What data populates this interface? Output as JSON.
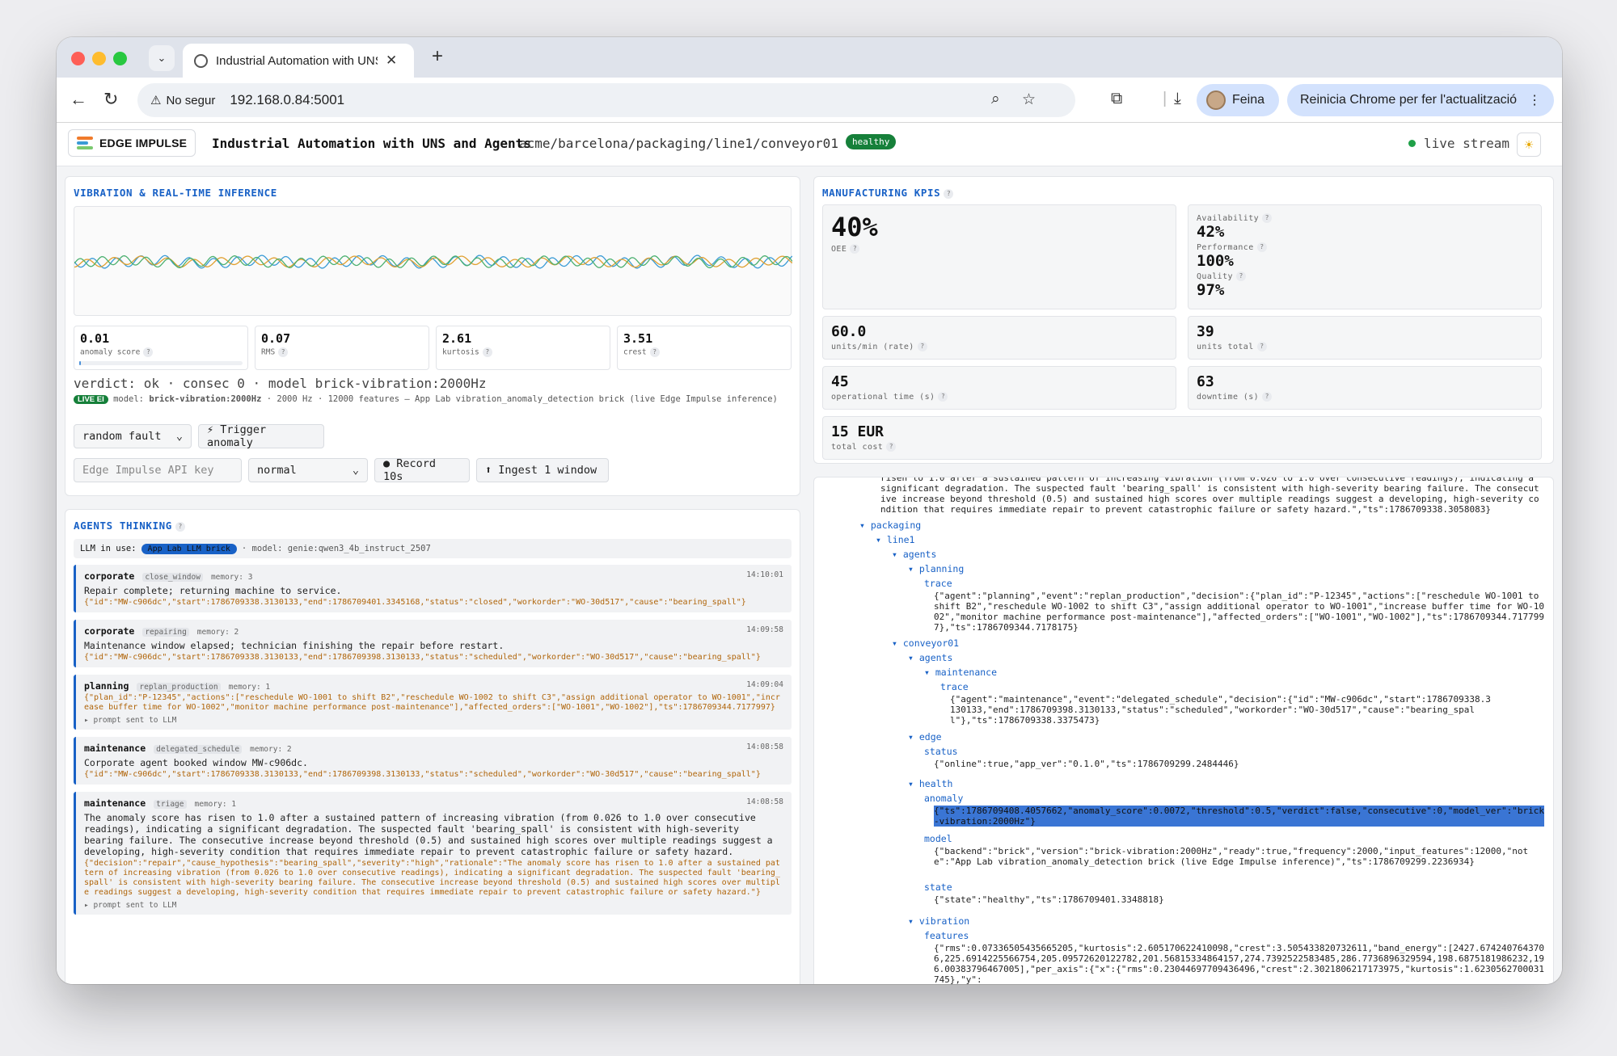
{
  "browser": {
    "tab_title": "Industrial Automation with UNS",
    "security_label": "No segur",
    "url": "192.168.0.84:5001",
    "profile_name": "Feina",
    "update_label": "Reinicia Chrome per fer l'actualització"
  },
  "header": {
    "logo_text": "EDGE IMPULSE",
    "title": "Industrial Automation with UNS and Agents",
    "topic_path": "acme/barcelona/packaging/line1/conveyor01",
    "health_badge": "healthy",
    "live_label": "live stream"
  },
  "vibration": {
    "title": "VIBRATION & REAL-TIME INFERENCE",
    "metrics": [
      {
        "value": "0.01",
        "label": "anomaly score",
        "fill": 0.01
      },
      {
        "value": "0.07",
        "label": "RMS"
      },
      {
        "value": "2.61",
        "label": "kurtosis"
      },
      {
        "value": "3.51",
        "label": "crest"
      }
    ],
    "verdict": "verdict: ok · consec 0 · model brick-vibration:2000Hz",
    "live_badge": "LIVE EI",
    "model_prefix": "model:",
    "model_name": "brick-vibration:2000Hz",
    "model_desc": " · 2000 Hz · 12000 features — App Lab vibration_anomaly_detection brick (live Edge Impulse inference)",
    "fault_select": "random fault",
    "trigger_button": "⚡ Trigger anomaly",
    "api_key_placeholder": "Edge Impulse API key",
    "mode_select": "normal",
    "record_button": "● Record 10s",
    "ingest_button": "⬆ Ingest 1 window"
  },
  "agents": {
    "title": "AGENTS THINKING",
    "llm_label": "LLM in use:",
    "llm_badge": "App Lab LLM brick",
    "llm_model": "· model: genie:qwen3_4b_instruct_2507",
    "cards": [
      {
        "agent": "corporate",
        "event": "close_window",
        "memory": "memory: 3",
        "time": "14:10:01",
        "message": "Repair complete; returning machine to service.",
        "json": "{\"id\":\"MW-c906dc\",\"start\":1786709338.3130133,\"end\":1786709401.3345168,\"status\":\"closed\",\"workorder\":\"WO-30d517\",\"cause\":\"bearing_spall\"}",
        "prompt": ""
      },
      {
        "agent": "corporate",
        "event": "repairing",
        "memory": "memory: 2",
        "time": "14:09:58",
        "message": "Maintenance window elapsed; technician finishing the repair before restart.",
        "json": "{\"id\":\"MW-c906dc\",\"start\":1786709338.3130133,\"end\":1786709398.3130133,\"status\":\"scheduled\",\"workorder\":\"WO-30d517\",\"cause\":\"bearing_spall\"}",
        "prompt": ""
      },
      {
        "agent": "planning",
        "event": "replan_production",
        "memory": "memory: 1",
        "time": "14:09:04",
        "message": "",
        "json": "{\"plan_id\":\"P-12345\",\"actions\":[\"reschedule WO-1001 to shift B2\",\"reschedule WO-1002 to shift C3\",\"assign additional operator to WO-1001\",\"increase buffer time for WO-1002\",\"monitor machine performance post-maintenance\"],\"affected_orders\":[\"WO-1001\",\"WO-1002\"],\"ts\":1786709344.7177997}",
        "prompt": "▸ prompt sent to LLM"
      },
      {
        "agent": "maintenance",
        "event": "delegated_schedule",
        "memory": "memory: 2",
        "time": "14:08:58",
        "message": "Corporate agent booked window MW-c906dc.",
        "json": "{\"id\":\"MW-c906dc\",\"start\":1786709338.3130133,\"end\":1786709398.3130133,\"status\":\"scheduled\",\"workorder\":\"WO-30d517\",\"cause\":\"bearing_spall\"}",
        "prompt": ""
      },
      {
        "agent": "maintenance",
        "event": "triage",
        "memory": "memory: 1",
        "time": "14:08:58",
        "message": "The anomaly score has risen to 1.0 after a sustained pattern of increasing vibration (from 0.026 to 1.0 over consecutive readings), indicating a significant degradation. The suspected fault 'bearing_spall' is consistent with high-severity bearing failure. The consecutive increase beyond threshold (0.5) and sustained high scores over multiple readings suggest a developing, high-severity condition that requires immediate repair to prevent catastrophic failure or safety hazard.",
        "json": "{\"decision\":\"repair\",\"cause_hypothesis\":\"bearing_spall\",\"severity\":\"high\",\"rationale\":\"The anomaly score has risen to 1.0 after a sustained pattern of increasing vibration (from 0.026 to 1.0 over consecutive readings), indicating a significant degradation. The suspected fault 'bearing_spall' is consistent with high-severity bearing failure. The consecutive increase beyond threshold (0.5) and sustained high scores over multiple readings suggest a developing, high-severity condition that requires immediate repair to prevent catastrophic failure or safety hazard.\"}",
        "prompt": "▸ prompt sent to LLM"
      }
    ]
  },
  "kpis": {
    "title": "MANUFACTURING KPIS",
    "oee": {
      "value": "40%",
      "label": "OEE"
    },
    "availability": {
      "label": "Availability",
      "value": "42%"
    },
    "performance": {
      "label": "Performance",
      "value": "100%"
    },
    "quality": {
      "label": "Quality",
      "value": "97%"
    },
    "rate": {
      "value": "60.0",
      "label": "units/min (rate)"
    },
    "units_total": {
      "value": "39",
      "label": "units total"
    },
    "op_time": {
      "value": "45",
      "label": "operational time (s)"
    },
    "downtime": {
      "value": "63",
      "label": "downtime (s)"
    },
    "cost": {
      "value": "15 EUR",
      "label": "total cost"
    }
  },
  "uns_tree": {
    "top_text": "risen to 1.0 after a sustained pattern of increasing vibration (from 0.026 to 1.0 over consecutive readings), indicating a significant degradation. The suspected fault 'bearing_spall' is consistent with high-severity bearing failure. The consecutive increase beyond threshold (0.5) and sustained high scores over multiple readings suggest a developing, high-severity condition that requires immediate repair to prevent catastrophic failure or safety hazard.\",\"ts\":1786709338.3058083}",
    "packaging": "packaging",
    "line1": "line1",
    "agents": "agents",
    "planning": "planning",
    "trace": "trace",
    "planning_trace": "{\"agent\":\"planning\",\"event\":\"replan_production\",\"decision\":{\"plan_id\":\"P-12345\",\"actions\":[\"reschedule WO-1001 to shift B2\",\"reschedule WO-1002 to shift C3\",\"assign additional operator to WO-1001\",\"increase buffer time for WO-1002\",\"monitor machine performance post-maintenance\"],\"affected_orders\":[\"WO-1001\",\"WO-1002\"],\"ts\":1786709344.7177997},\"ts\":1786709344.7178175}",
    "conveyor01": "conveyor01",
    "agents2": "agents",
    "maintenance": "maintenance",
    "trace2": "trace",
    "maintenance_trace": "{\"agent\":\"maintenance\",\"event\":\"delegated_schedule\",\"decision\":{\"id\":\"MW-c906dc\",\"start\":1786709338.3130133,\"end\":1786709398.3130133,\"status\":\"scheduled\",\"workorder\":\"WO-30d517\",\"cause\":\"bearing_spall\"},\"ts\":1786709338.3375473}",
    "edge": "edge",
    "status": "status",
    "edge_status": "{\"online\":true,\"app_ver\":\"0.1.0\",\"ts\":1786709299.2484446}",
    "health": "health",
    "anomaly": "anomaly",
    "anomaly_value": "{\"ts\":1786709408.4057662,\"anomaly_score\":0.0072,\"threshold\":0.5,\"verdict\":false,\"consecutive\":0,\"model_ver\":\"brick-vibration:2000Hz\"}",
    "model": "model",
    "model_value": "{\"backend\":\"brick\",\"version\":\"brick-vibration:2000Hz\",\"ready\":true,\"frequency\":2000,\"input_features\":12000,\"note\":\"App Lab vibration_anomaly_detection brick (live Edge Impulse inference)\",\"ts\":1786709299.2236934}",
    "state": "state",
    "state_value": "{\"state\":\"healthy\",\"ts\":1786709401.3348818}",
    "vibration": "vibration",
    "features": "features",
    "features_value": "{\"rms\":0.07336505435665205,\"kurtosis\":2.605170622410098,\"crest\":3.505433820732611,\"band_energy\":[2427.6742407643706,225.6914225566754,205.09572620122782,201.56815334864157,274.7392522583485,286.7736896329594,198.6875181986232,196.00383796467005],\"per_axis\":{\"x\":{\"rms\":0.23044697709436496,\"crest\":2.3021806217173975,\"kurtosis\":1.6230562700031745},\"y\":"
  },
  "colors": {
    "accent": "#1861c6",
    "healthy": "#16803a",
    "json_text": "#b0650a",
    "wave": [
      "#3a9bd6",
      "#e0a030",
      "#4cb070"
    ]
  }
}
